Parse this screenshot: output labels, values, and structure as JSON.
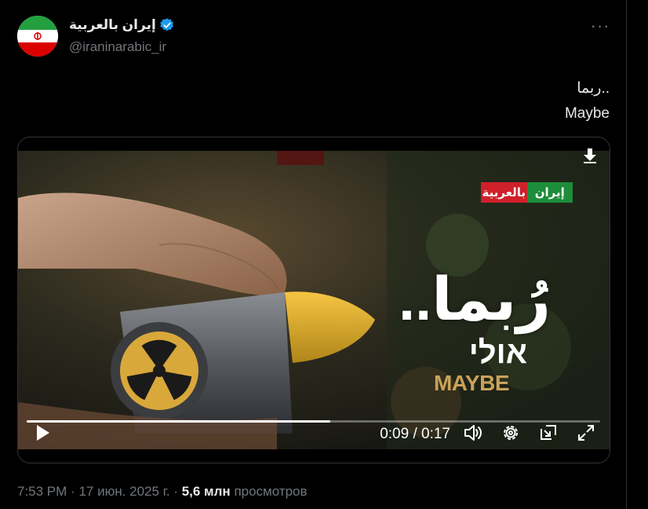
{
  "author": {
    "display_name": "إيران بالعربية",
    "handle": "@iraninarabic_ir",
    "verified": true,
    "avatar": "iran-flag-avatar"
  },
  "tweet": {
    "lines": [
      "ربما..",
      "Maybe"
    ]
  },
  "video": {
    "brand_logo_text_left": "إيران",
    "brand_logo_text_right": "بالعربية",
    "overlay_arabic": "رُبما..",
    "overlay_hebrew": "אולי",
    "overlay_english": "MAYBE",
    "current_time": "0:09",
    "duration": "0:17",
    "time_display": "0:09 / 0:17",
    "progress": 0.53
  },
  "meta": {
    "time": "7:53 PM",
    "separator": "·",
    "date": "17 июн. 2025 г.",
    "views_count": "5,6 млн",
    "views_label": "просмотров"
  },
  "colors": {
    "background": "#000000",
    "text": "#e7e9ea",
    "secondary_text": "#71767b",
    "verified_badge": "#1d9bf0",
    "overlay_gold": "#caa259"
  }
}
